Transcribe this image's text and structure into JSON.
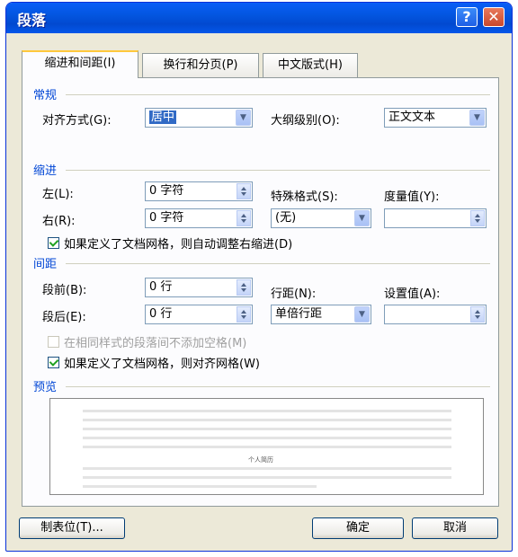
{
  "window": {
    "title": "段落"
  },
  "titlebar": {
    "help_label": "?",
    "close_label": "✕"
  },
  "tabs": [
    {
      "label": "缩进和间距(I)",
      "active": true
    },
    {
      "label": "换行和分页(P)",
      "active": false
    },
    {
      "label": "中文版式(H)",
      "active": false
    }
  ],
  "general": {
    "heading": "常规",
    "alignment_label": "对齐方式(G):",
    "alignment_value": "居中",
    "outline_label": "大纲级别(O):",
    "outline_value": "正文文本"
  },
  "indent": {
    "heading": "缩进",
    "left_label": "左(L):",
    "left_value": "0 字符",
    "right_label": "右(R):",
    "right_value": "0 字符",
    "special_label": "特殊格式(S):",
    "special_value": "(无)",
    "by_label": "度量值(Y):",
    "by_value": "",
    "auto_adjust_label": "如果定义了文档网格，则自动调整右缩进(D)",
    "auto_adjust_checked": true
  },
  "spacing": {
    "heading": "间距",
    "before_label": "段前(B):",
    "before_value": "0 行",
    "after_label": "段后(E):",
    "after_value": "0 行",
    "line_label": "行距(N):",
    "line_value": "单倍行距",
    "at_label": "设置值(A):",
    "at_value": "",
    "no_space_label": "在相同样式的段落间不添加空格(M)",
    "no_space_checked": false,
    "snap_grid_label": "如果定义了文档网格，则对齐网格(W)",
    "snap_grid_checked": true
  },
  "preview": {
    "heading": "预览",
    "sample_text": "个人简历"
  },
  "buttons": {
    "tabs_label": "制表位(T)...",
    "ok_label": "确定",
    "cancel_label": "取消"
  },
  "colors": {
    "title_bar": "#0a5ef7",
    "section_heading": "#0046d5",
    "dialog_bg": "#ece9d8",
    "selection": "#316ac5"
  }
}
